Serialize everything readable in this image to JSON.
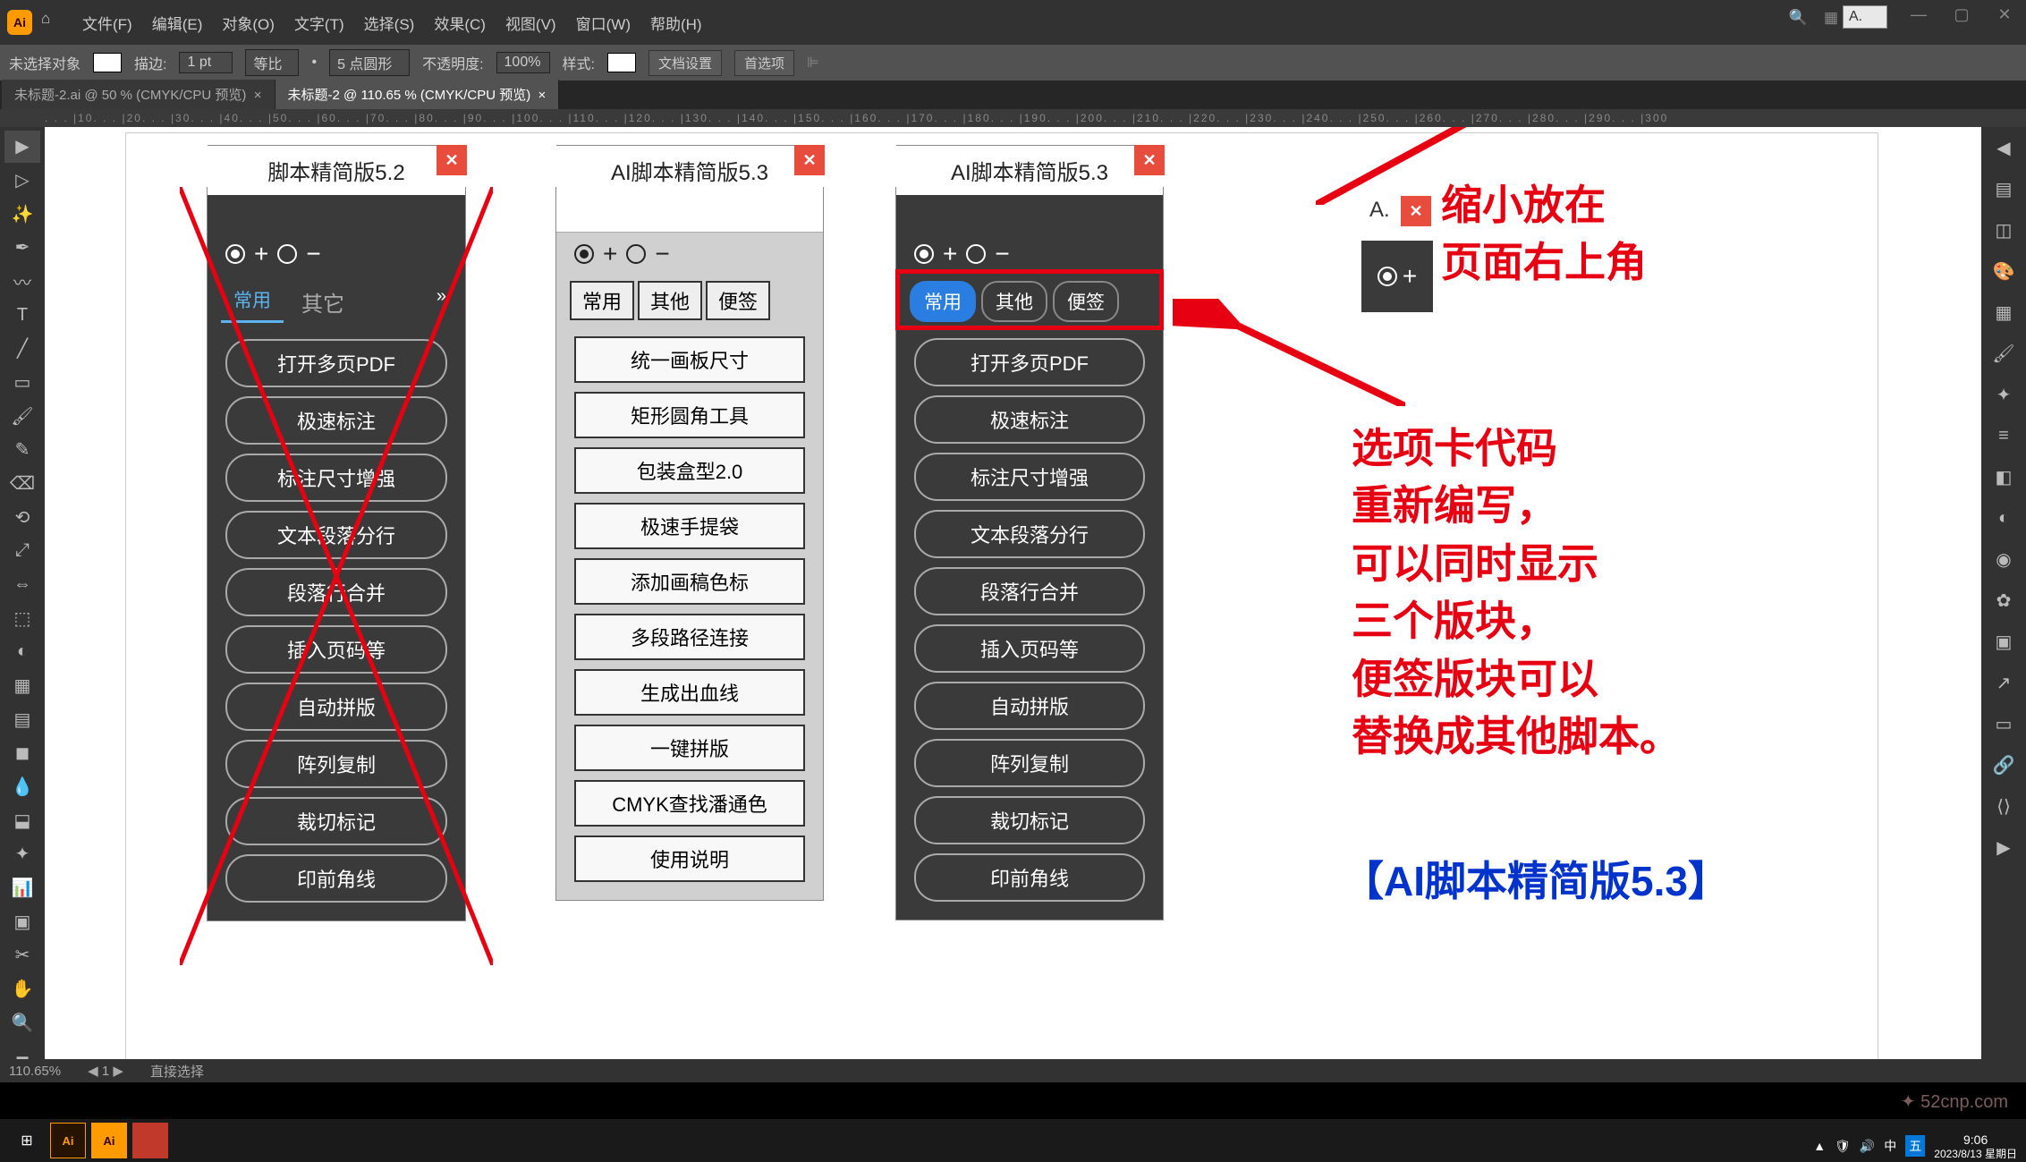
{
  "app": {
    "logo": "Ai",
    "menus": [
      "文件(F)",
      "编辑(E)",
      "对象(O)",
      "文字(T)",
      "选择(S)",
      "效果(C)",
      "视图(V)",
      "窗口(W)",
      "帮助(H)"
    ]
  },
  "control_bar": {
    "no_selection": "未选择对象",
    "stroke_label": "描边:",
    "stroke_val": "1 pt",
    "uniform": "等比",
    "pt_round": "5 点圆形",
    "opacity_label": "不透明度:",
    "opacity_val": "100%",
    "style_label": "样式:",
    "doc_setup": "文档设置",
    "prefs": "首选项"
  },
  "tabs": [
    {
      "label": "未标题-2.ai @ 50 % (CMYK/CPU 预览)",
      "active": false
    },
    {
      "label": "未标题-2 @ 110.65 % (CMYK/CPU 预览)",
      "active": true
    }
  ],
  "ruler": ". . . |10. . . |20. . . |30. . . |40. . . |50. . . |60. . . |70. . . |80. . . |90. . . |100. . . |110. . . |120. . . |130. . . |140. . . |150. . . |160. . . |170. . . |180. . . |190. . . |200. . . |210. . . |220. . . |230. . . |240. . . |250. . . |260. . . |270. . . |280. . . |290. . . |300",
  "panel52": {
    "title": "脚本精简版5.2",
    "tabs": [
      "常用",
      "其它"
    ],
    "buttons": [
      "打开多页PDF",
      "极速标注",
      "标注尺寸增强",
      "文本段落分行",
      "段落行合并",
      "插入页码等",
      "自动拼版",
      "阵列复制",
      "裁切标记",
      "印前角线"
    ]
  },
  "panel53_light": {
    "title": "AI脚本精简版5.3",
    "tabs": [
      "常用",
      "其他",
      "便签"
    ],
    "buttons": [
      "统一画板尺寸",
      "矩形圆角工具",
      "包装盒型2.0",
      "极速手提袋",
      "添加画稿色标",
      "多段路径连接",
      "生成出血线",
      "一键拼版",
      "CMYK查找潘通色",
      "使用说明"
    ]
  },
  "panel53_dark": {
    "title": "AI脚本精简版5.3",
    "tabs": [
      "常用",
      "其他",
      "便签"
    ],
    "buttons": [
      "打开多页PDF",
      "极速标注",
      "标注尺寸增强",
      "文本段落分行",
      "段落行合并",
      "插入页码等",
      "自动拼版",
      "阵列复制",
      "裁切标记",
      "印前角线"
    ]
  },
  "mini_toolbar_label": "A.",
  "annot1": "缩小放在\n页面右上角",
  "annot2": "选项卡代码\n重新编写，\n可以同时显示\n三个版块，\n便签版块可以\n替换成其他脚本。",
  "annot3": "【AI脚本精简版5.3】",
  "status": {
    "zoom": "110.65%",
    "nav": "1",
    "tool": "直接选择"
  },
  "taskbar": {
    "time": "9:06",
    "date": "2023/8/13 星期日"
  },
  "watermark": "52cnp.com"
}
